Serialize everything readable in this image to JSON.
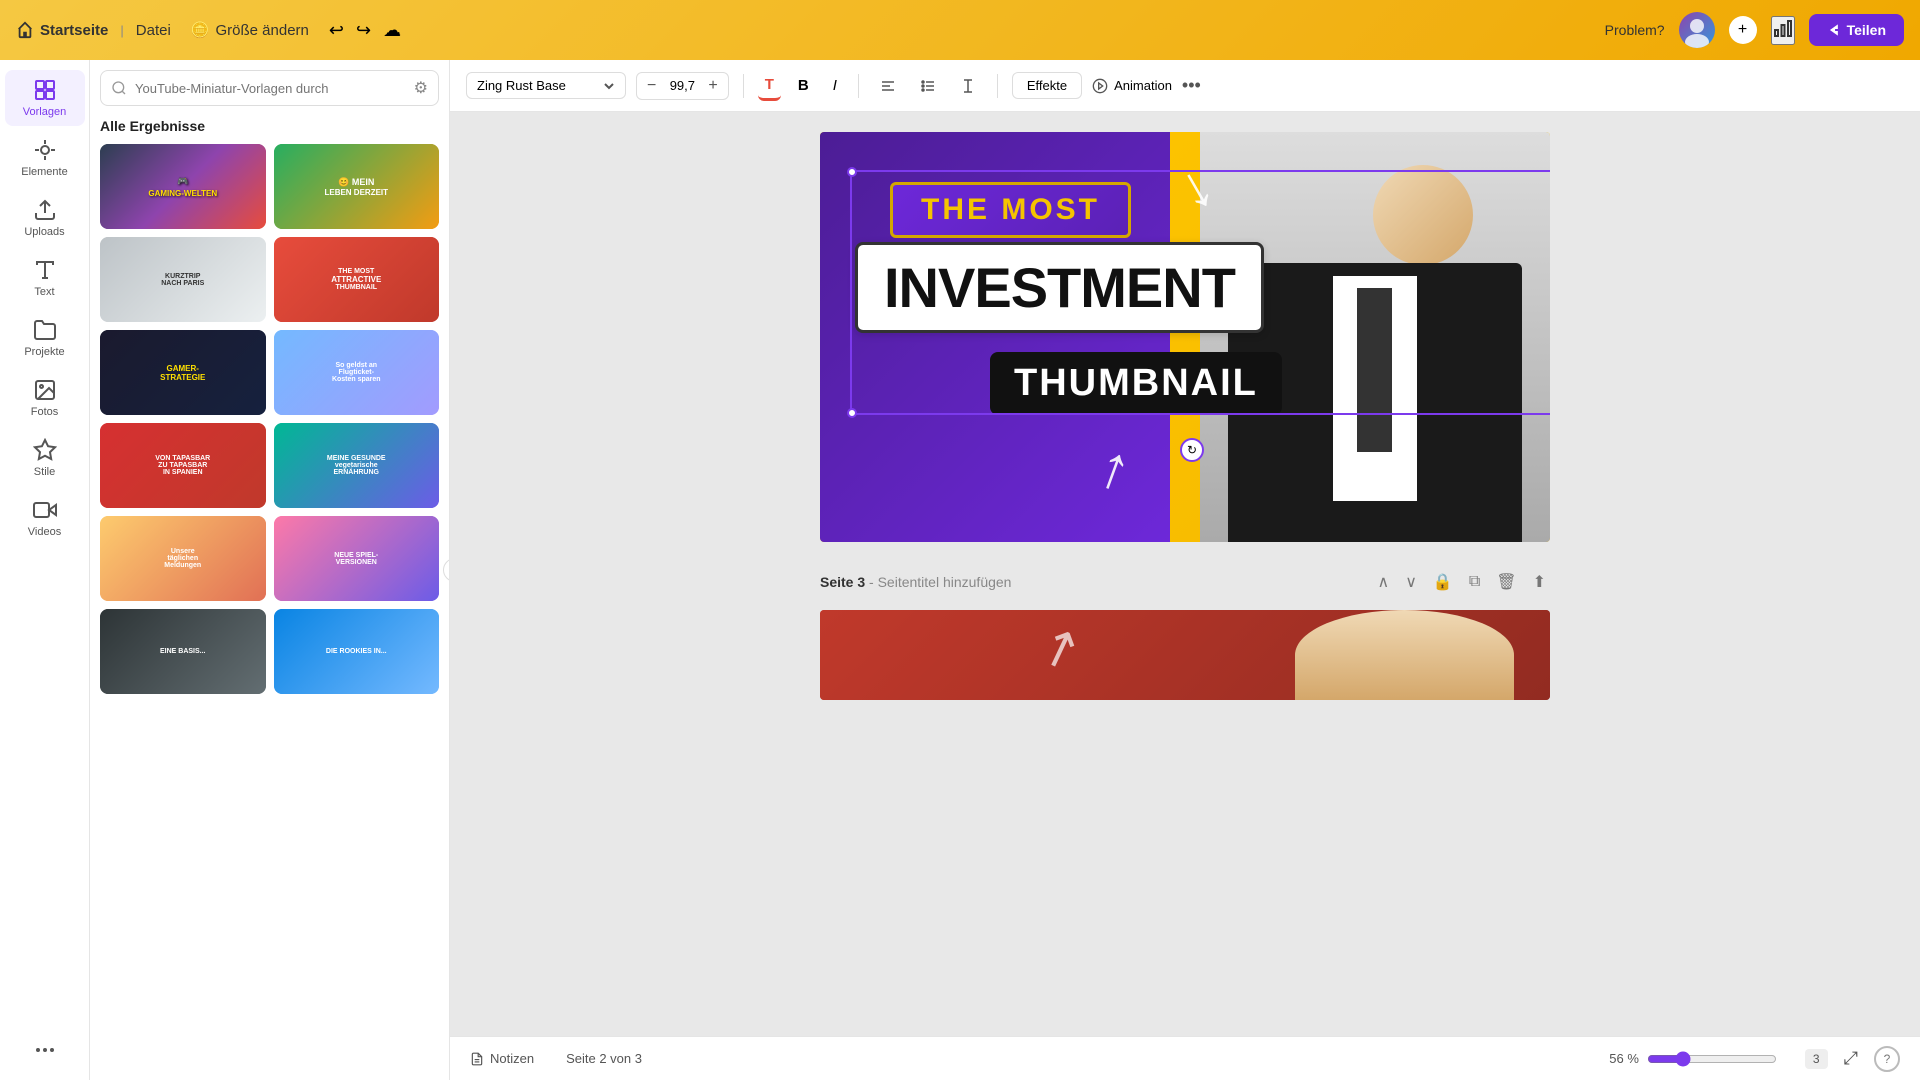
{
  "topbar": {
    "home": "Startseite",
    "file": "Datei",
    "size_change": "Größe ändern",
    "problem": "Problem?",
    "share": "Teilen"
  },
  "toolbar": {
    "font": "Zing Rust Base",
    "font_size": "99,7",
    "effects": "Effekte",
    "animation": "Animation"
  },
  "sidebar": {
    "items": [
      {
        "label": "Vorlagen",
        "icon": "grid-icon"
      },
      {
        "label": "Elemente",
        "icon": "shapes-icon"
      },
      {
        "label": "Uploads",
        "icon": "upload-icon"
      },
      {
        "label": "Text",
        "icon": "text-icon"
      },
      {
        "label": "Projekte",
        "icon": "folder-icon"
      },
      {
        "label": "Fotos",
        "icon": "photo-icon"
      },
      {
        "label": "Stile",
        "icon": "style-icon"
      },
      {
        "label": "Videos",
        "icon": "video-icon"
      }
    ]
  },
  "search": {
    "placeholder": "YouTube-Miniatur-Vorlagen durch"
  },
  "results_title": "Alle Ergebnisse",
  "templates": [
    {
      "id": 1,
      "color_class": "t1",
      "label": "GAMING-WELTEN",
      "tag": ""
    },
    {
      "id": 2,
      "color_class": "t2",
      "label": "MEIN LEBEN DERZEIT",
      "tag": ""
    },
    {
      "id": 3,
      "color_class": "t3",
      "label": "KURZTRIP NACH PARIS",
      "tag": ""
    },
    {
      "id": 4,
      "color_class": "t4",
      "label": "THE MOST ATTRACTIVE THUMBNAIL",
      "tag": ""
    },
    {
      "id": 5,
      "color_class": "t5",
      "label": "GAMER-STRATEGIE",
      "tag": ""
    },
    {
      "id": 6,
      "color_class": "t6",
      "label": "So geldst an Flugticket-Kosten sparen",
      "tag": ""
    },
    {
      "id": 7,
      "color_class": "t7",
      "label": "VON TAPASBAR ZU TAPASBAR IN SPANIEN",
      "tag": ""
    },
    {
      "id": 8,
      "color_class": "t8",
      "label": "MEINE GESUNDE vegetarische ERNÄHRUNG",
      "tag": ""
    },
    {
      "id": 9,
      "color_class": "t9",
      "label": "Unsere täglichen Meldungen",
      "tag": ""
    },
    {
      "id": 10,
      "color_class": "t10",
      "label": "NEUE SPIELVERSIONEN",
      "tag": ""
    },
    {
      "id": 11,
      "color_class": "t11",
      "label": "EINE BASIS...",
      "tag": ""
    },
    {
      "id": 12,
      "color_class": "t12",
      "label": "DIE ROOKIES IN...",
      "tag": ""
    }
  ],
  "canvas": {
    "text1": "THE MOST",
    "text2": "INVESTMENT",
    "text3": "THUMBNAIL",
    "page_label": "Seite 3",
    "page_hint": "Seitentitel hinzufügen"
  },
  "bottombar": {
    "notes": "Notizen",
    "page_current": "Seite 2 von 3",
    "zoom": "56 %"
  }
}
